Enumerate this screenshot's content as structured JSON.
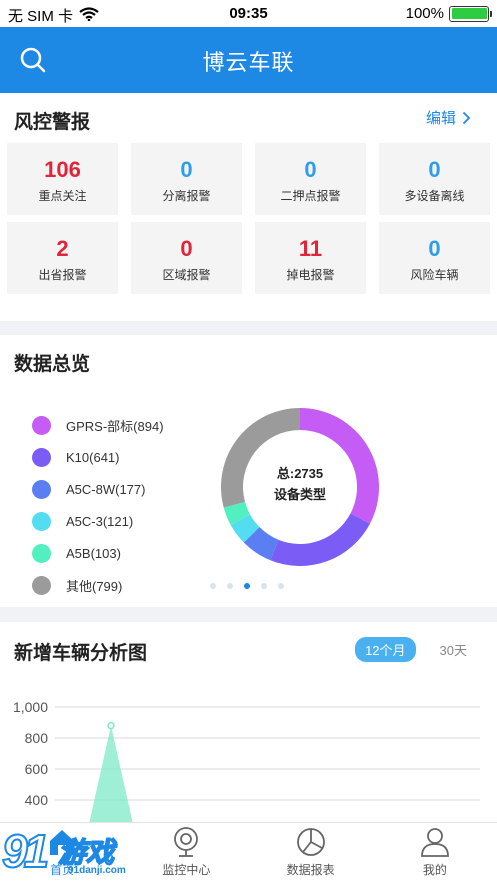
{
  "status_bar": {
    "carrier": "无 SIM 卡",
    "time": "09:35",
    "battery": "100%"
  },
  "header": {
    "title": "博云车联",
    "search_icon": "search-icon"
  },
  "risk": {
    "title": "风控警报",
    "edit_label": "编辑",
    "cards": [
      {
        "value": "106",
        "label": "重点关注",
        "color": "#e0243a"
      },
      {
        "value": "0",
        "label": "分离报警",
        "color": "#2f9de8"
      },
      {
        "value": "0",
        "label": "二押点报警",
        "color": "#2f9de8"
      },
      {
        "value": "0",
        "label": "多设备离线",
        "color": "#2f9de8"
      },
      {
        "value": "2",
        "label": "出省报警",
        "color": "#e0243a"
      },
      {
        "value": "0",
        "label": "区域报警",
        "color": "#e0243a"
      },
      {
        "value": "11",
        "label": "掉电报警",
        "color": "#e0243a"
      },
      {
        "value": "0",
        "label": "风险车辆",
        "color": "#2f9de8"
      }
    ]
  },
  "overview": {
    "title": "数据总览",
    "center_line1": "总:2735",
    "center_line2": "设备类型",
    "legend": [
      {
        "label": "GPRS-部标(894)",
        "color": "#c55cf5"
      },
      {
        "label": "K10(641)",
        "color": "#7b5cf5"
      },
      {
        "label": "A5C-8W(177)",
        "color": "#5b7ff2"
      },
      {
        "label": "A5C-3(121)",
        "color": "#52def0"
      },
      {
        "label": "A5B(103)",
        "color": "#52f0c0"
      },
      {
        "label": "其他(799)",
        "color": "#9b9b9b"
      }
    ],
    "pager": {
      "count": 5,
      "active": 2
    }
  },
  "chart_data": {
    "type": "area",
    "title": "新增车辆分析图",
    "periods": [
      "12个月",
      "30天"
    ],
    "active_period": "12个月",
    "y_ticks": [
      "1,000",
      "800",
      "600",
      "400"
    ],
    "ylim": [
      0,
      1000
    ],
    "visible_peak": 880,
    "color": "#7fe8c8"
  },
  "tabbar": {
    "items": [
      {
        "label": "首页",
        "icon": "home-icon"
      },
      {
        "label": "监控中心",
        "icon": "camera-icon"
      },
      {
        "label": "数据报表",
        "icon": "pie-chart-icon"
      },
      {
        "label": "我的",
        "icon": "user-icon"
      }
    ]
  },
  "watermark": {
    "brand": "91",
    "brand_text": "游戏",
    "site": "91danji.com"
  }
}
